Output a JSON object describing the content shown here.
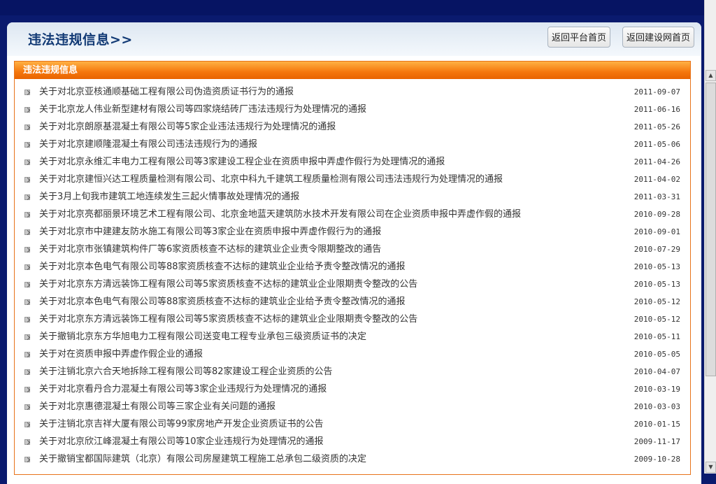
{
  "page": {
    "title": "违法违规信息>>"
  },
  "header_buttons": {
    "platform_home": "返回平台首页",
    "jsw_home": "返回建设网首页"
  },
  "box": {
    "heading": "违法违规信息"
  },
  "news": [
    {
      "title": "关于对北京亚核通顺基础工程有限公司伪造资质证书行为的通报",
      "date": "2011-09-07"
    },
    {
      "title": "关于北京龙人伟业新型建材有限公司等四家烧结砖厂违法违规行为处理情况的通报",
      "date": "2011-06-16"
    },
    {
      "title": "关于对北京朗原基混凝土有限公司等5家企业违法违规行为处理情况的通报",
      "date": "2011-05-26"
    },
    {
      "title": "关于对北京建顺隆混凝土有限公司违法违规行为的通报",
      "date": "2011-05-06"
    },
    {
      "title": "关于对北京永维汇丰电力工程有限公司等3家建设工程企业在资质申报中弄虚作假行为处理情况的通报",
      "date": "2011-04-26"
    },
    {
      "title": "关于对北京建恒兴达工程质量检测有限公司、北京中科九千建筑工程质量检测有限公司违法违规行为处理情况的通报",
      "date": "2011-04-02"
    },
    {
      "title": "关于3月上旬我市建筑工地连续发生三起火情事故处理情况的通报",
      "date": "2011-03-31"
    },
    {
      "title": "关于对北京亮都丽景环境艺术工程有限公司、北京金地蓝天建筑防水技术开发有限公司在企业资质申报中弄虚作假的通报",
      "date": "2010-09-28"
    },
    {
      "title": "关于对北京市中建建友防水施工有限公司等3家企业在资质申报中弄虚作假行为的通报",
      "date": "2010-09-01"
    },
    {
      "title": "关于对北京市张镇建筑构件厂等6家资质核查不达标的建筑业企业责令限期整改的通告",
      "date": "2010-07-29"
    },
    {
      "title": "关于对北京本色电气有限公司等88家资质核查不达标的建筑业企业给予责令整改情况的通报",
      "date": "2010-05-13"
    },
    {
      "title": "关于对北京东方清远装饰工程有限公司等5家资质核查不达标的建筑业企业限期责令整改的公告",
      "date": "2010-05-13"
    },
    {
      "title": "关于对北京本色电气有限公司等88家资质核查不达标的建筑业企业给予责令整改情况的通报",
      "date": "2010-05-12"
    },
    {
      "title": "关于对北京东方清远装饰工程有限公司等5家资质核查不达标的建筑业企业限期责令整改的公告",
      "date": "2010-05-12"
    },
    {
      "title": "关于撤销北京东方华旭电力工程有限公司送变电工程专业承包三级资质证书的决定",
      "date": "2010-05-11"
    },
    {
      "title": "关于对在资质申报中弄虚作假企业的通报",
      "date": "2010-05-05"
    },
    {
      "title": "关于注销北京六合天地拆除工程有限公司等82家建设工程企业资质的公告",
      "date": "2010-04-07"
    },
    {
      "title": "关于对北京看丹合力混凝土有限公司等3家企业违规行为处理情况的通报",
      "date": "2010-03-19"
    },
    {
      "title": "关于对北京惠德混凝土有限公司等三家企业有关问题的通报",
      "date": "2010-03-03"
    },
    {
      "title": "关于注销北京吉祥大厦有限公司等99家房地产开发企业资质证书的公告",
      "date": "2010-01-15"
    },
    {
      "title": "关于对北京欣江峰混凝土有限公司等10家企业违规行为处理情况的通报",
      "date": "2009-11-17"
    },
    {
      "title": "关于撤销宝都国际建筑（北京）有限公司房屋建筑工程施工总承包二级资质的决定",
      "date": "2009-10-28"
    }
  ],
  "scrollbar": {
    "up_icon": "▲",
    "down_icon": "▼"
  }
}
